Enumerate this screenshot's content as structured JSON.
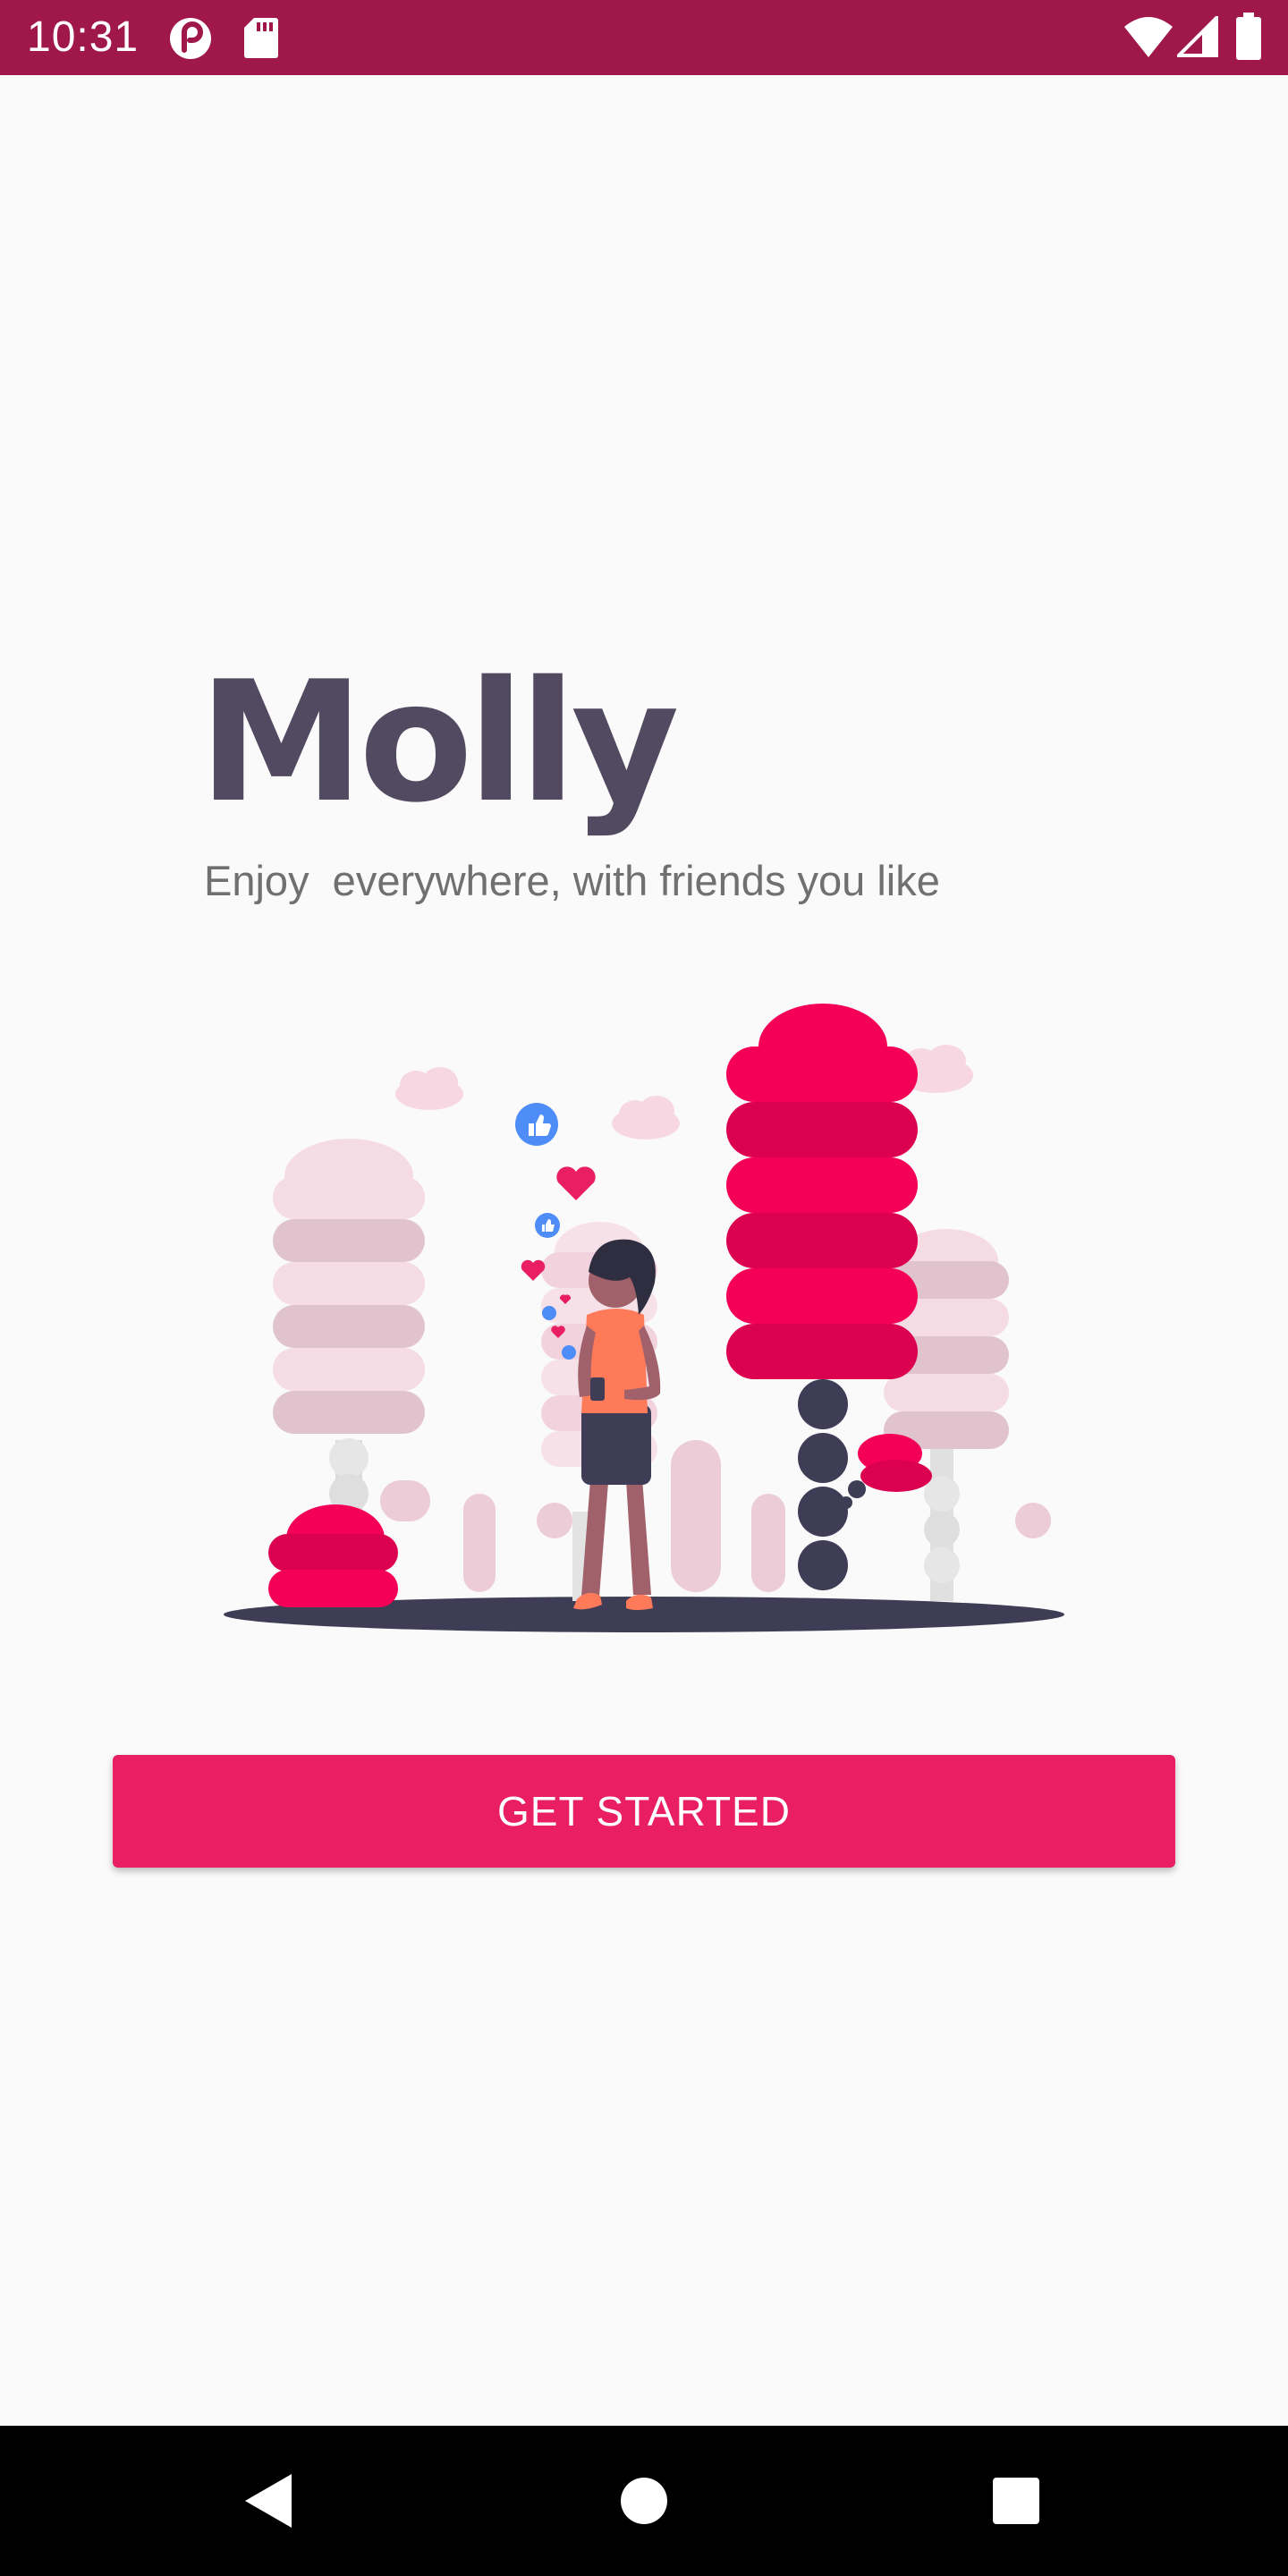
{
  "status_bar": {
    "time": "10:31",
    "background": "#a0184a",
    "left_icons": [
      "pocket-casts-icon",
      "sd-card-icon"
    ],
    "right_icons": [
      "wifi-icon",
      "cell-signal-icon",
      "battery-icon"
    ]
  },
  "main": {
    "app_title": "Molly",
    "tagline": "Enjoy  everywhere, with friends you like",
    "illustration": "woman-with-phone-social-likes-illustration",
    "get_started_label": "GET STARTED",
    "accent_color": "#e91e63",
    "title_color": "#514a60"
  },
  "nav_bar": {
    "buttons": [
      "back-icon",
      "home-icon",
      "recents-icon"
    ]
  }
}
